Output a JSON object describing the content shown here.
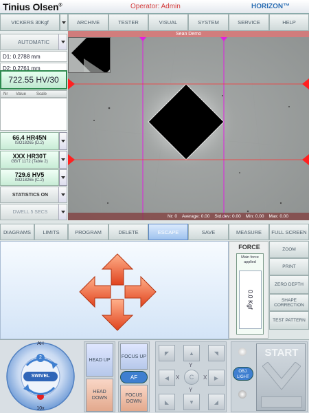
{
  "header": {
    "logo": "Tinius Olsen",
    "logo_mark": "®",
    "operator": "Operator: Admin",
    "product": "HORIZON™"
  },
  "top_menu": {
    "scale": "VICKERS 30Kgf",
    "items": [
      "ARCHIVE",
      "TESTER",
      "VISUAL",
      "SYSTEM",
      "SERVICE",
      "HELP"
    ]
  },
  "left_panel": {
    "mode_button": "AUTOMATIC",
    "d1": "D1: 0.2788 mm",
    "d2": "D2: 0.2761 mm",
    "hardness": "722.55 HV/30",
    "table_headers": [
      "Nr",
      "Value",
      "Scale"
    ],
    "conversions": [
      {
        "value": "66.4 HR45N",
        "standard": "ISO18265 (D.2)"
      },
      {
        "value": "XXX HR30T",
        "standard": "GB/T 1172 (Table 2)"
      },
      {
        "value": "729.6 HV5",
        "standard": "ISO18265 (C.2)"
      }
    ],
    "statistics": "STATISTICS ON",
    "dwell": "DWELL 5 SECS"
  },
  "image_view": {
    "title": "Sean Demo",
    "stats": {
      "nr": "Nr: 0",
      "average": "Average: 0.00",
      "std": "Std.dev: 0.00",
      "min": "Min: 0.00",
      "max": "Max: 0.00"
    }
  },
  "mid_menu": [
    "DIAGRAMS",
    "LIMITS",
    "PROGRAM",
    "DELETE",
    "ESCAPE",
    "SAVE",
    "MEASURE",
    "FULL SCREEN"
  ],
  "force_panel": {
    "title": "FORCE",
    "label": "Main force applied",
    "value": "0.0 Kgf"
  },
  "right_menu": [
    "ZOOM",
    "PRINT",
    "ZERO DEPTH",
    "SHAPE CORRECTION",
    "TEST PATTERN"
  ],
  "bottom": {
    "turret": {
      "top": "AH",
      "position": "2",
      "label": "SWIVEL",
      "bottom": "10x"
    },
    "head_up": "HEAD UP",
    "head_down": "HEAD DOWN",
    "focus_up": "FOCUS UP",
    "af": "AF",
    "focus_down": "FOCUS DOWN",
    "jog": {
      "y_top": "Y",
      "x_left": "X",
      "center": "C",
      "x_right": "X",
      "y_bottom": "Y"
    },
    "obj_light": "OBJ. LIGHT",
    "start": "START"
  },
  "colors": {
    "accent": "#e0431e",
    "overlay_line": "#ff1a1a",
    "magenta_line": "#e020e0",
    "green": "#2d8a4e",
    "blue": "#3a7ad1"
  }
}
